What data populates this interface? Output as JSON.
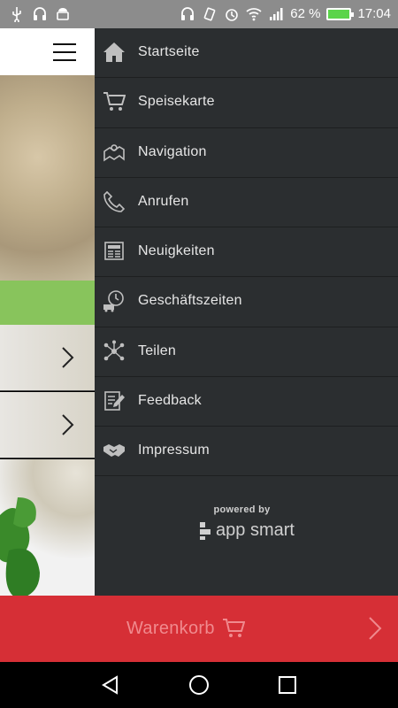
{
  "statusbar": {
    "battery": "62 %",
    "time": "17:04",
    "icons": [
      "usb-icon",
      "headset-icon",
      "android-icon",
      "headphones-icon",
      "vibrate-icon",
      "alarm-icon",
      "wifi-icon",
      "signal-icon",
      "battery-icon"
    ]
  },
  "drawer": {
    "items": [
      {
        "label": "Startseite",
        "icon": "home-icon"
      },
      {
        "label": "Speisekarte",
        "icon": "cart-icon"
      },
      {
        "label": "Navigation",
        "icon": "map-icon"
      },
      {
        "label": "Anrufen",
        "icon": "phone-icon"
      },
      {
        "label": "Neuigkeiten",
        "icon": "newspaper-icon"
      },
      {
        "label": "Geschäftszeiten",
        "icon": "delivery-clock-icon"
      },
      {
        "label": "Teilen",
        "icon": "share-icon"
      },
      {
        "label": "Feedback",
        "icon": "feedback-icon"
      },
      {
        "label": "Impressum",
        "icon": "handshake-icon"
      }
    ],
    "powered_by": "powered by",
    "brand": "app smart"
  },
  "cart": {
    "label": "Warenkorb"
  },
  "colors": {
    "drawer_bg": "#2b2e30",
    "cart_bg": "#d62f36",
    "accent_green": "#88c45c"
  }
}
